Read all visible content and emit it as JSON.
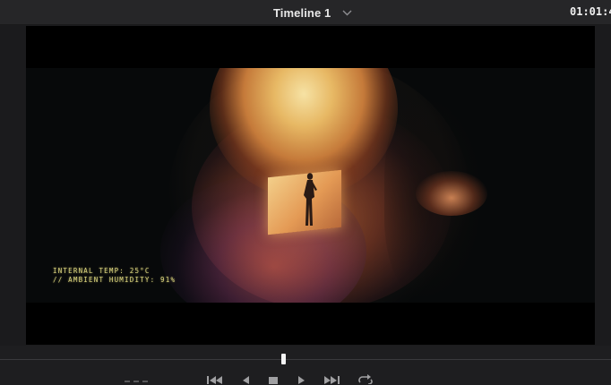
{
  "header": {
    "timeline_title": "Timeline 1",
    "timecode": "01:01:4"
  },
  "viewer": {
    "hud_lines": "INTERNAL TEMP: 25°C\n// AMBIENT HUMIDITY: 91%"
  },
  "icons": {
    "timeline_dropdown": "chevron-down-icon",
    "go_to_start": "skip-back-icon",
    "play_reverse": "play-reverse-icon",
    "stop": "stop-icon",
    "play": "play-icon",
    "go_to_end": "skip-forward-icon",
    "loop": "loop-icon"
  },
  "colors": {
    "panel_bg": "#1e1e20",
    "header_bg": "#262628",
    "hud_text": "#d9d27c",
    "playhead": "#f4f4f4"
  }
}
